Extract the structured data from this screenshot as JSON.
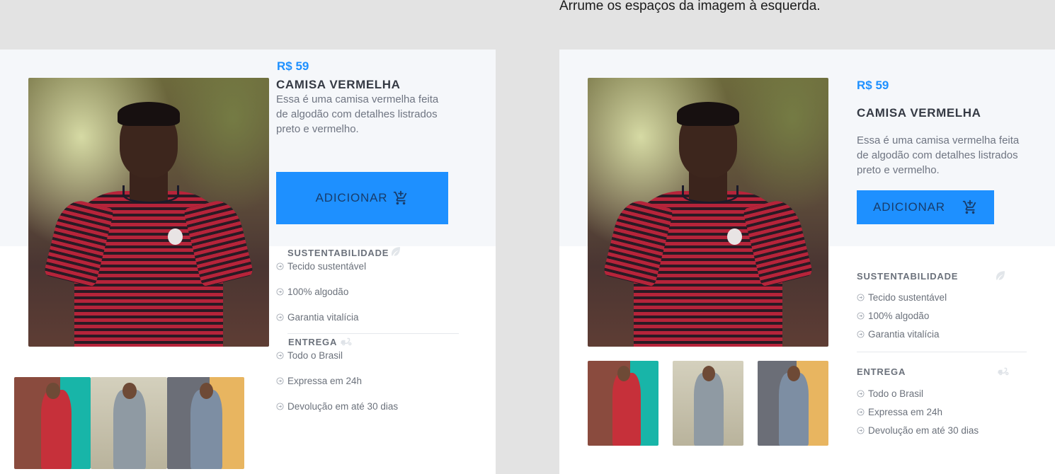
{
  "instruction": "Arrume os espaços da imagem à esquerda.",
  "product": {
    "price": "R$ 59",
    "name": "CAMISA VERMELHA",
    "description": "Essa é uma camisa vermelha feita de algodão com detalhes listrados preto e vermelho.",
    "button_label": "ADICIONAR",
    "button_icon": "add-to-cart-icon"
  },
  "sections": {
    "sustainability": {
      "title": "SUSTENTABILIDADE",
      "icon": "leaf-icon",
      "items": [
        "Tecido sustentável",
        "100% algodão",
        "Garantia vitalícia"
      ]
    },
    "delivery": {
      "title": "ENTREGA",
      "icon": "scooter-icon",
      "items": [
        "Todo o Brasil",
        "Expressa em 24h",
        "Devolução em até 30 dias"
      ]
    }
  },
  "colors": {
    "accent": "#1e90ff",
    "band": "#f5f7fa",
    "background": "#e3e3e3"
  }
}
